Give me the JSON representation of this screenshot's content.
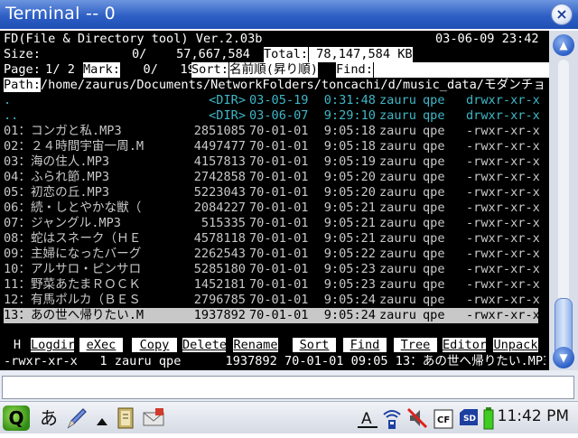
{
  "window": {
    "title": "Terminal -- 0",
    "close_glyph": "×"
  },
  "terminal": {
    "header": {
      "app_name": "FD(File & Directory tool) Ver.2.03b",
      "datetime": "03-06-09 23:42",
      "size_label": "Size:",
      "size_value": "0/    57,667,584",
      "total_label": "Total:",
      "total_value": " 78,147,584 KB",
      "page_label": "Page:",
      "page_value": " 1/ 2",
      "mark_label": "Mark:",
      "mark_value": "   0/   19",
      "sort_label": "Sort:",
      "sort_value": "名前順(昇り順)",
      "find_label": "Find:",
      "path_label": "Path:",
      "path_value": "/home/zaurus/Documents/NetworkFolders/toncachi/d/music_data/モダンチョ"
    },
    "files": [
      {
        "name": ".",
        "size": "<DIR>",
        "date": "03-05-19",
        "time": "0:31:48",
        "owner": "zauru",
        "group": "qpe",
        "perm": "drwxr-xr-x",
        "type": "dir"
      },
      {
        "name": "..",
        "size": "<DIR>",
        "date": "03-06-07",
        "time": "9:29:10",
        "owner": "zauru",
        "group": "qpe",
        "perm": "drwxr-xr-x",
        "type": "dir"
      },
      {
        "name": "01：コンガと私.MP3",
        "size": "2851085",
        "date": "70-01-01",
        "time": "9:05:18",
        "owner": "zauru",
        "group": "qpe",
        "perm": "-rwxr-xr-x",
        "type": "file"
      },
      {
        "name": "02：２４時間宇宙一周.M",
        "size": "4497477",
        "date": "70-01-01",
        "time": "9:05:18",
        "owner": "zauru",
        "group": "qpe",
        "perm": "-rwxr-xr-x",
        "type": "file"
      },
      {
        "name": "03：海の住人.MP3",
        "size": "4157813",
        "date": "70-01-01",
        "time": "9:05:19",
        "owner": "zauru",
        "group": "qpe",
        "perm": "-rwxr-xr-x",
        "type": "file"
      },
      {
        "name": "04：ふられ節.MP3",
        "size": "2742858",
        "date": "70-01-01",
        "time": "9:05:20",
        "owner": "zauru",
        "group": "qpe",
        "perm": "-rwxr-xr-x",
        "type": "file"
      },
      {
        "name": "05：初恋の丘.MP3",
        "size": "5223043",
        "date": "70-01-01",
        "time": "9:05:20",
        "owner": "zauru",
        "group": "qpe",
        "perm": "-rwxr-xr-x",
        "type": "file"
      },
      {
        "name": "06：続・しとやかな獣（",
        "size": "2084227",
        "date": "70-01-01",
        "time": "9:05:21",
        "owner": "zauru",
        "group": "qpe",
        "perm": "-rwxr-xr-x",
        "type": "file"
      },
      {
        "name": "07：ジャングル.MP3",
        "size": "515335",
        "date": "70-01-01",
        "time": "9:05:21",
        "owner": "zauru",
        "group": "qpe",
        "perm": "-rwxr-xr-x",
        "type": "file"
      },
      {
        "name": "08：蛇はスネーク（ＨＥ",
        "size": "4578118",
        "date": "70-01-01",
        "time": "9:05:21",
        "owner": "zauru",
        "group": "qpe",
        "perm": "-rwxr-xr-x",
        "type": "file"
      },
      {
        "name": "09：主婦になったバーグ",
        "size": "2262543",
        "date": "70-01-01",
        "time": "9:05:22",
        "owner": "zauru",
        "group": "qpe",
        "perm": "-rwxr-xr-x",
        "type": "file"
      },
      {
        "name": "10：アルサロ・ピンサロ",
        "size": "5285180",
        "date": "70-01-01",
        "time": "9:05:23",
        "owner": "zauru",
        "group": "qpe",
        "perm": "-rwxr-xr-x",
        "type": "file"
      },
      {
        "name": "11：野菜あたまＲＯＣＫ",
        "size": "1452181",
        "date": "70-01-01",
        "time": "9:05:23",
        "owner": "zauru",
        "group": "qpe",
        "perm": "-rwxr-xr-x",
        "type": "file"
      },
      {
        "name": "12：有馬ポルカ（ＢＥＳ",
        "size": "2796785",
        "date": "70-01-01",
        "time": "9:05:24",
        "owner": "zauru",
        "group": "qpe",
        "perm": "-rwxr-xr-x",
        "type": "file"
      },
      {
        "name": "13：あの世へ帰りたい.M",
        "size": "1937892",
        "date": "70-01-01",
        "time": "9:05:24",
        "owner": "zauru",
        "group": "qpe",
        "perm": "-rwxr-xr-x",
        "type": "file",
        "selected": true
      }
    ],
    "function_keys": [
      {
        "label": "H"
      },
      {
        "label": "Logdir"
      },
      {
        "label": "eXec"
      },
      {
        "label": "Copy"
      },
      {
        "label": "Delete"
      },
      {
        "label": "Rename"
      },
      {
        "label": "Sort"
      },
      {
        "label": "Find"
      },
      {
        "label": "Tree"
      },
      {
        "label": "Editor"
      },
      {
        "label": "Unpack"
      }
    ],
    "status_line": "-rwxr-xr-x   1 zauru qpe      1937892 70-01-01 09:05 13：あの世へ帰りたい.MP3"
  },
  "scrollbar": {
    "up_glyph": "▲",
    "down_glyph": "▼"
  },
  "input_line": {
    "value": ""
  },
  "taskbar": {
    "launcher_glyph": "Q",
    "ime_mode": "あ",
    "clock": "11:42 PM",
    "icons": [
      "q-launcher-icon",
      "pen-icon",
      "up-arrow-icon",
      "notebook-icon",
      "mail-icon",
      "keyboard-icon",
      "network-icon",
      "mute-speaker-icon",
      "cf-card-icon",
      "sd-card-icon",
      "battery-icon"
    ]
  },
  "colors": {
    "titlebar": "#2e5fc4",
    "terminal_bg": "#000000",
    "dir_entry": "#3fb7c7",
    "selection": "#c8c8c8"
  }
}
